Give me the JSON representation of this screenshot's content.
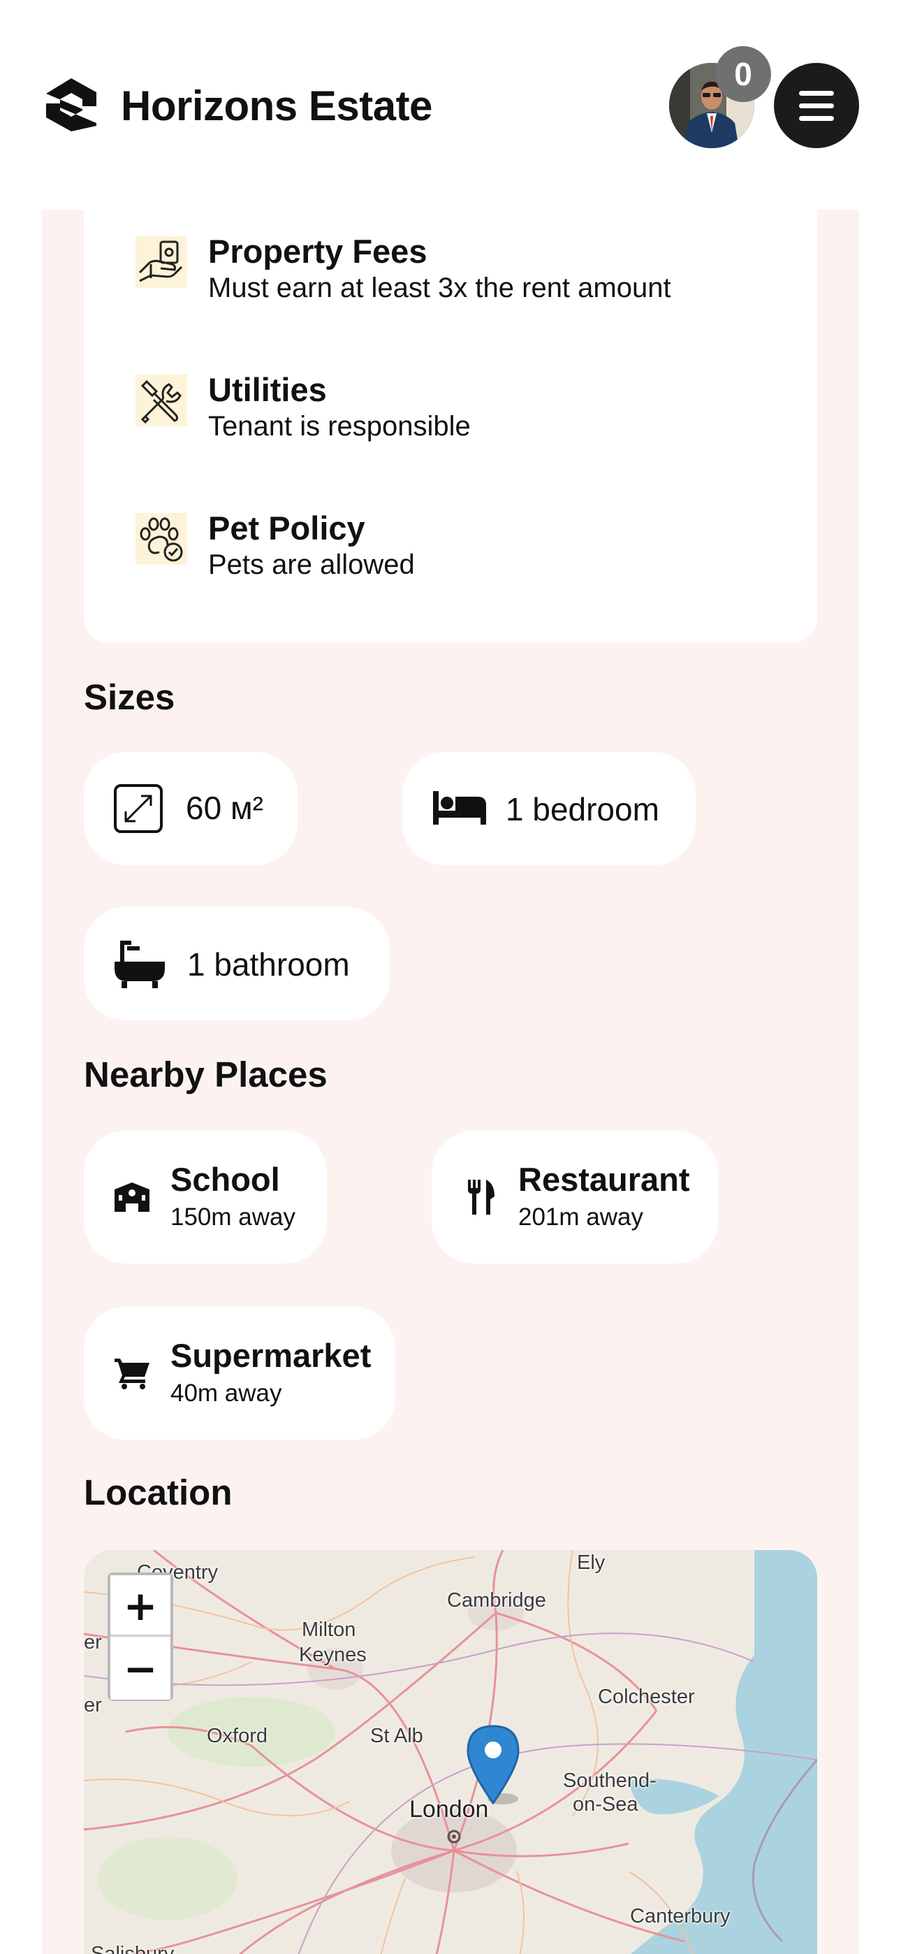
{
  "header": {
    "brand": "Horizons Estate",
    "notification_count": "0"
  },
  "rules": [
    {
      "title": "Property Fees",
      "text": "Must earn at least 3x the rent amount",
      "icon": "money-hand-icon"
    },
    {
      "title": "Utilities",
      "text": "Tenant is responsible",
      "icon": "tools-icon"
    },
    {
      "title": "Pet Policy",
      "text": "Pets are allowed",
      "icon": "paw-check-icon"
    }
  ],
  "sizes": {
    "title": "Sizes",
    "area": "60 м²",
    "bedrooms": "1 bedroom",
    "bathrooms": "1 bathroom"
  },
  "nearby": {
    "title": "Nearby Places",
    "places": [
      {
        "name": "School",
        "distance": "150m away",
        "icon": "school-icon"
      },
      {
        "name": "Restaurant",
        "distance": "201m away",
        "icon": "fork-knife-icon"
      },
      {
        "name": "Supermarket",
        "distance": "40m away",
        "icon": "cart-icon"
      }
    ]
  },
  "location": {
    "title": "Location",
    "zoom_in": "+",
    "zoom_out": "−",
    "labels": {
      "coventry": "Coventry",
      "ely": "Ely",
      "cambridge": "Cambridge",
      "milton": "Milton",
      "keynes": "Keynes",
      "colchester": "Colchester",
      "oxford": "Oxford",
      "st_albans": "St Alb",
      "london": "London",
      "southend": "Southend-",
      "on_sea": "on-Sea",
      "canterbury": "Canterbury",
      "salisbury": "Salisbury",
      "edge_left_1": "er",
      "edge_left_2": "er"
    }
  },
  "colors": {
    "panel_bg": "#fcf3f1",
    "dark": "#1b1b1b",
    "badge": "#707070",
    "marker": "#2f86d1",
    "sea": "#aad3df"
  }
}
